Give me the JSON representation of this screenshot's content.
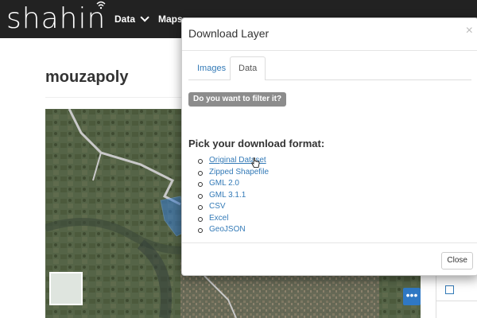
{
  "nav": {
    "brand": "shahin",
    "items": [
      {
        "label": "Data",
        "has_caret": true
      },
      {
        "label": "Maps",
        "has_caret": false
      }
    ]
  },
  "page": {
    "title": "mouzapoly"
  },
  "map": {
    "more_button_label": "•••",
    "basemap_thumb_icon": "layers-thumbnail",
    "road_color": "#c9c9c9",
    "vector_color": "#3b7fd4"
  },
  "modal": {
    "title": "Download Layer",
    "close_icon": "×",
    "tabs": [
      {
        "label": "Images",
        "active": false
      },
      {
        "label": "Data",
        "active": true
      }
    ],
    "filter_button_label": "Do you want to filter it?",
    "format_heading": "Pick your download format:",
    "formats": [
      "Original Dataset",
      "Zipped Shapefile",
      "GML 2.0",
      "GML 3.1.1",
      "CSV",
      "Excel",
      "GeoJSON"
    ],
    "footer_close_label": "Close"
  },
  "colors": {
    "navbar_bg": "#222222",
    "link": "#337ab7",
    "filter_btn_bg": "#8c8c8c",
    "more_btn_bg": "#2f78c4"
  }
}
